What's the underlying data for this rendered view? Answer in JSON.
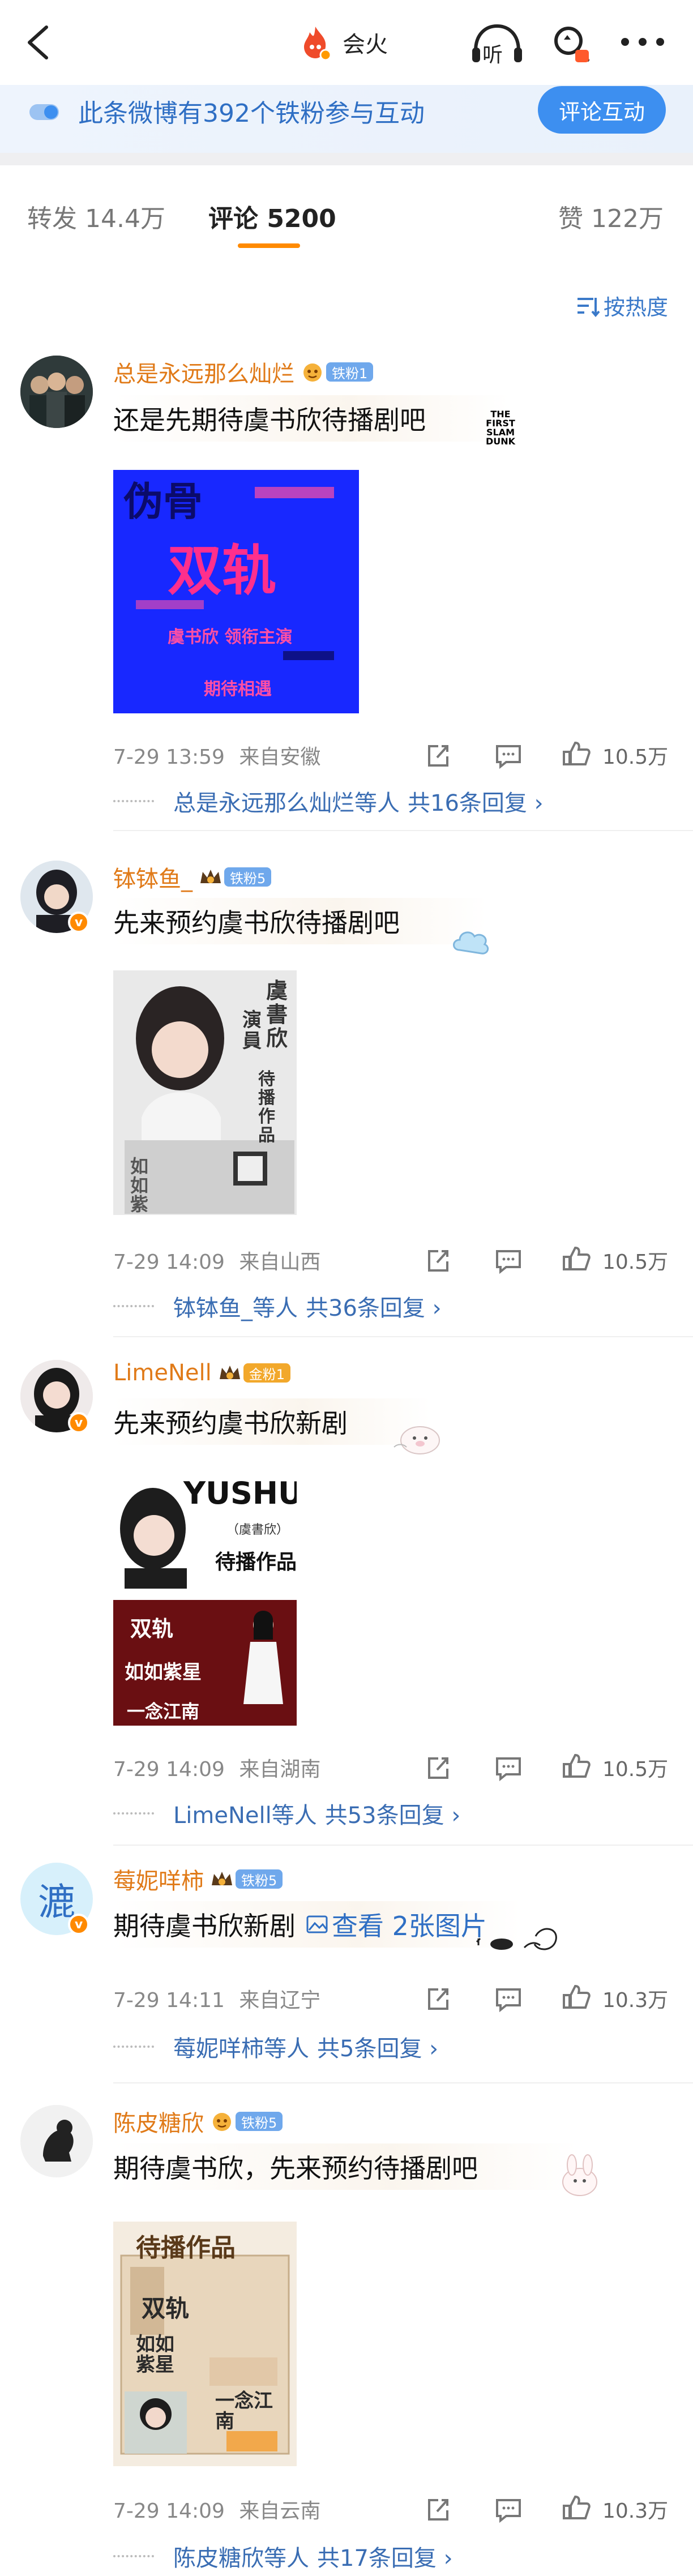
{
  "header": {
    "title": "会火",
    "listen_label": "听"
  },
  "banner": {
    "text": "此条微博有392个铁粉参与互动",
    "button": "评论互动"
  },
  "tabs": {
    "repost": "转发 14.4万",
    "comment": "评论 5200",
    "like": "赞 122万"
  },
  "sort_label": "按热度",
  "comments": [
    {
      "user": "总是永远那么灿烂",
      "badge": "铁粉1",
      "text": "还是先期待虞书欣待播剧吧",
      "sticker_text": "THE FIRST SLAM DUNK",
      "image_text": {
        "line1": "伪骨",
        "line2": "双轨",
        "line3": "虞书欣 领衔主演",
        "line4": "期待相遇"
      },
      "time": "7-29 13:59",
      "location": "来自安徽",
      "likes": "10.5万",
      "reply": "总是永远那么灿烂等人",
      "reply_count": "共16条回复 ›"
    },
    {
      "user": "钵钵鱼_",
      "badge": "铁粉5",
      "text": "先来预约虞书欣待播剧吧",
      "image_text": {
        "title": "虞書欣",
        "role": "演員",
        "works": "待播作品",
        "drama": "如如紫星"
      },
      "time": "7-29 14:09",
      "location": "来自山西",
      "likes": "10.5万",
      "reply": "钵钵鱼_等人",
      "reply_count": "共36条回复 ›"
    },
    {
      "user": "LimeNell",
      "badge": "金粉1",
      "text": "先来预约虞书欣新剧",
      "image_text": {
        "name_en": "YUSHUXIN",
        "name_cn": "（虞書欣）",
        "works": "待播作品",
        "drama1": "双轨",
        "drama2": "如如紫星",
        "drama3": "一念江南"
      },
      "time": "7-29 14:09",
      "location": "来自湖南",
      "likes": "10.5万",
      "reply": "LimeNell等人",
      "reply_count": "共53条回复 ›"
    },
    {
      "user": "莓妮咩柿",
      "badge": "铁粉5",
      "avatar_char": "漉",
      "text": "期待虞书欣新剧",
      "view_images": "查看 2张图片",
      "time": "7-29 14:11",
      "location": "来自辽宁",
      "likes": "10.3万",
      "reply": "莓妮咩柿等人",
      "reply_count": "共5条回复 ›"
    },
    {
      "user": "陈皮糖欣",
      "badge": "铁粉5",
      "text": "期待虞书欣，先来预约待播剧吧",
      "image_text": {
        "title": "待播作品",
        "drama1": "双轨",
        "drama2": "如如紫星",
        "drama3": "一念江南"
      },
      "time": "7-29 14:09",
      "location": "来自云南",
      "likes": "10.3万",
      "reply": "陈皮糖欣等人",
      "reply_count": "共17条回复 ›"
    }
  ],
  "colors": {
    "accent_orange": "#ff8a00",
    "username": "#e07a18",
    "link_blue": "#2f6fc4",
    "button_blue": "#3d8ff0"
  }
}
